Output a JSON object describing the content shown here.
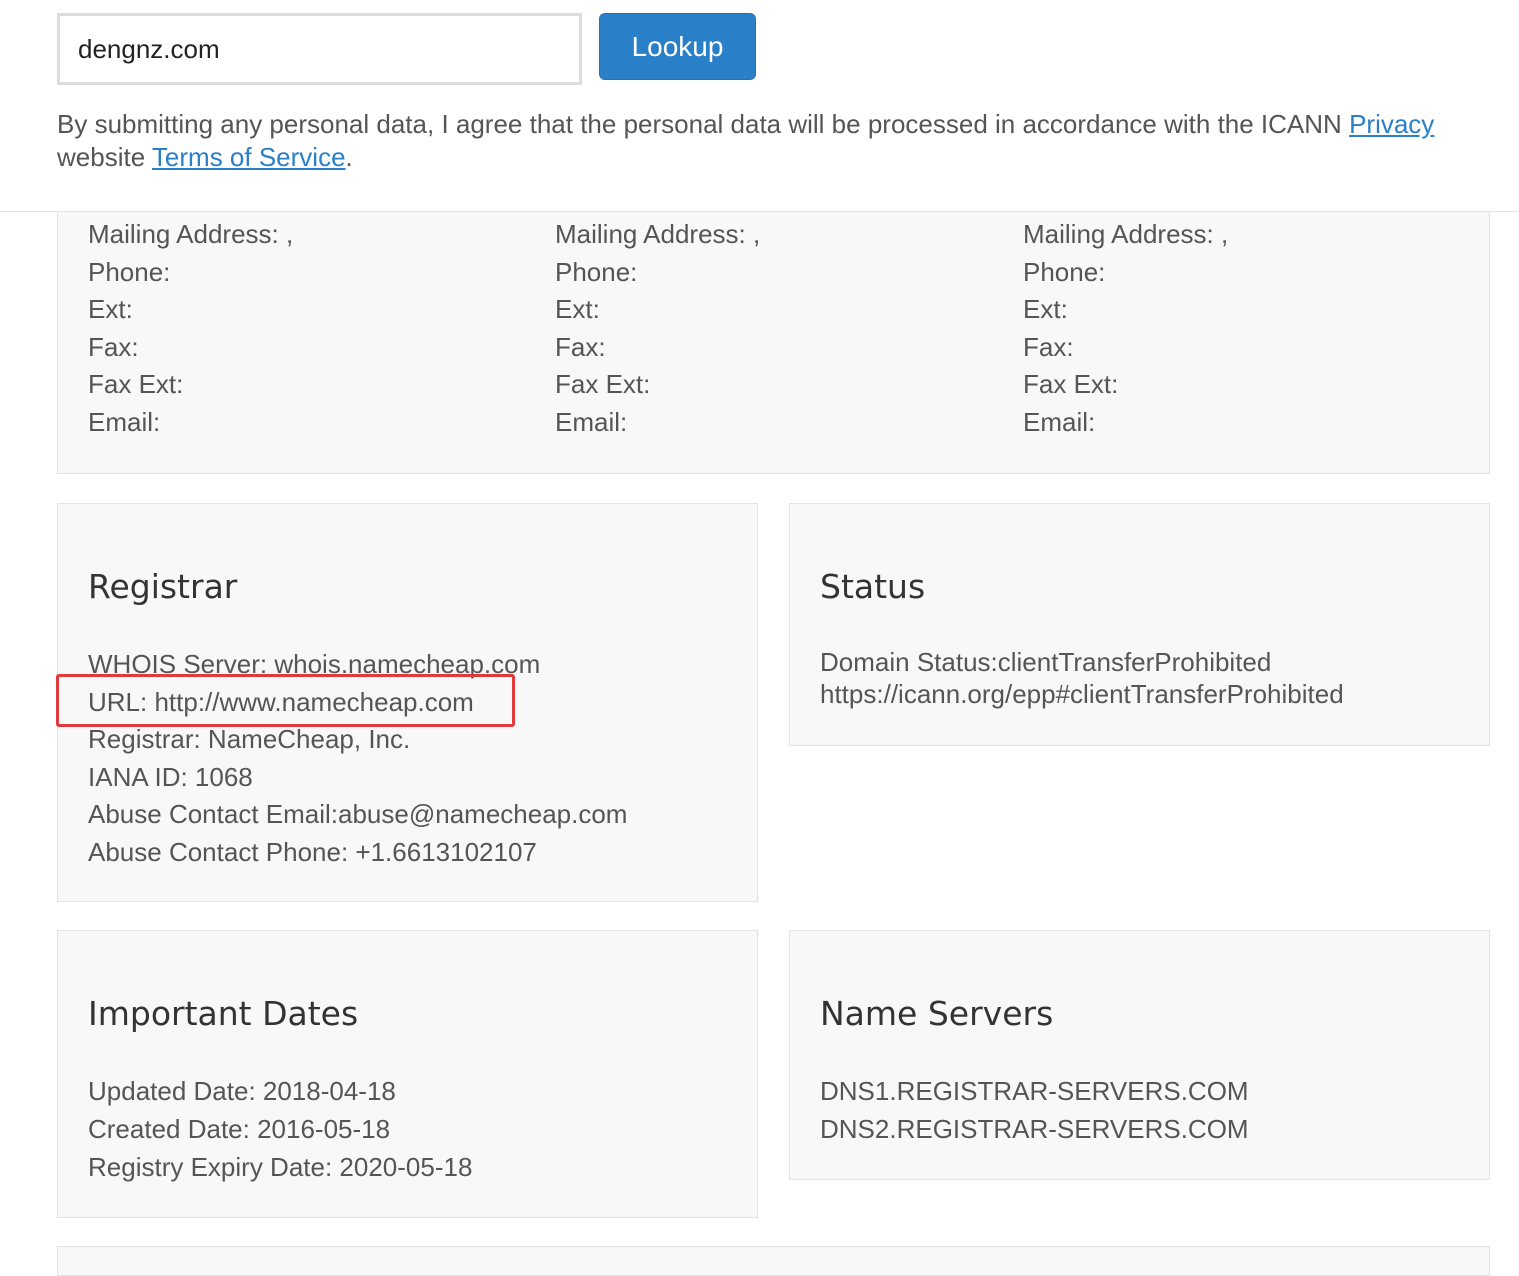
{
  "search": {
    "value": "dengnz.com",
    "button_label": "Lookup"
  },
  "notice": {
    "text_before": "By submitting any personal data, I agree that the personal data will be processed in accordance with the ICANN ",
    "privacy_link": "Privacy",
    "line2_before": "website ",
    "tos_link": "Terms of Service",
    "line2_after": "."
  },
  "contacts": [
    {
      "mailing_address": "Mailing Address: ,",
      "phone": "Phone:",
      "ext": "Ext:",
      "fax": "Fax:",
      "fax_ext": "Fax Ext:",
      "email": "Email:"
    },
    {
      "mailing_address": "Mailing Address: ,",
      "phone": "Phone:",
      "ext": "Ext:",
      "fax": "Fax:",
      "fax_ext": "Fax Ext:",
      "email": "Email:"
    },
    {
      "mailing_address": "Mailing Address: ,",
      "phone": "Phone:",
      "ext": "Ext:",
      "fax": "Fax:",
      "fax_ext": "Fax Ext:",
      "email": "Email:"
    }
  ],
  "registrar": {
    "title": "Registrar",
    "whois_server": "WHOIS Server: whois.namecheap.com",
    "url": "URL: http://www.namecheap.com",
    "registrar": "Registrar: NameCheap, Inc.",
    "iana_id": "IANA ID: 1068",
    "abuse_email": "Abuse Contact Email:abuse@namecheap.com",
    "abuse_phone": "Abuse Contact Phone: +1.6613102107"
  },
  "status": {
    "title": "Status",
    "line1": "Domain Status:clientTransferProhibited",
    "line2": "https://icann.org/epp#clientTransferProhibited"
  },
  "dates": {
    "title": "Important Dates",
    "updated": "Updated Date: 2018-04-18",
    "created": "Created Date: 2016-05-18",
    "expiry": "Registry Expiry Date: 2020-05-18"
  },
  "name_servers": {
    "title": "Name Servers",
    "ns1": "DNS1.REGISTRAR-SERVERS.COM",
    "ns2": "DNS2.REGISTRAR-SERVERS.COM"
  },
  "colors": {
    "accent": "#2a7fc9",
    "highlight": "#e03a3a",
    "panel_bg": "#f8f8f8"
  }
}
